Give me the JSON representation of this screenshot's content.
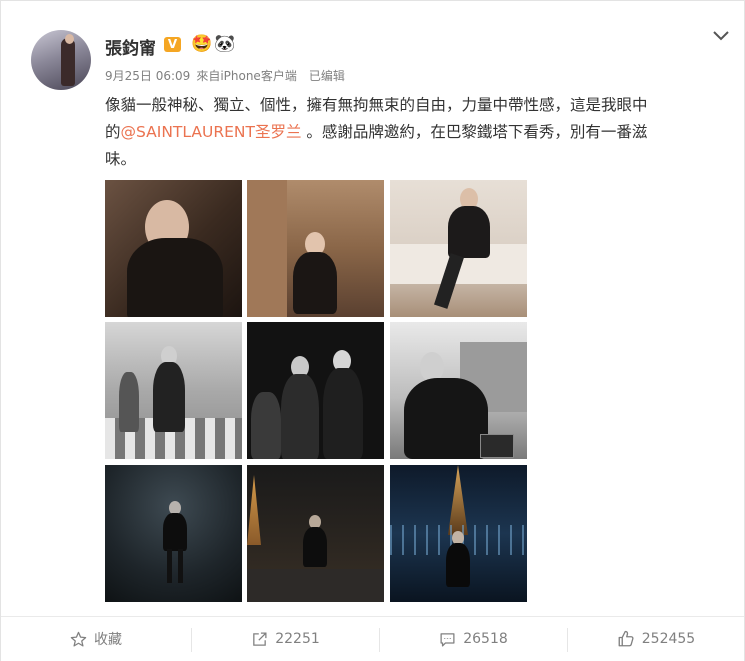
{
  "post": {
    "author": "張鈞甯",
    "badges": [
      "V",
      "🤩",
      "🐼"
    ],
    "time": "9月25日 06:09",
    "source": "來自iPhone客户端",
    "edited": "已编辑",
    "text_line1": "像貓一般神秘、獨立、個性，擁有無拘無束的自由，力量中帶性感，這是我眼中",
    "text_prefix": "的",
    "mention": "@SAINTLAURENT圣罗兰",
    "text_suffix": " 。感謝品牌邀約，在巴黎鐵塔下看秀，別有一番滋",
    "text_line3": "味。",
    "photo_count": 9
  },
  "actions": {
    "favorite_label": "收藏",
    "repost_count": "22251",
    "comment_count": "26518",
    "like_count": "252455"
  },
  "icons": [
    "chevron-down-icon",
    "star-icon",
    "share-icon",
    "comment-icon",
    "thumbs-up-icon"
  ],
  "colors": {
    "link": "#eb7350",
    "verified": "#f5a623",
    "text": "#333333",
    "meta": "#808080"
  }
}
